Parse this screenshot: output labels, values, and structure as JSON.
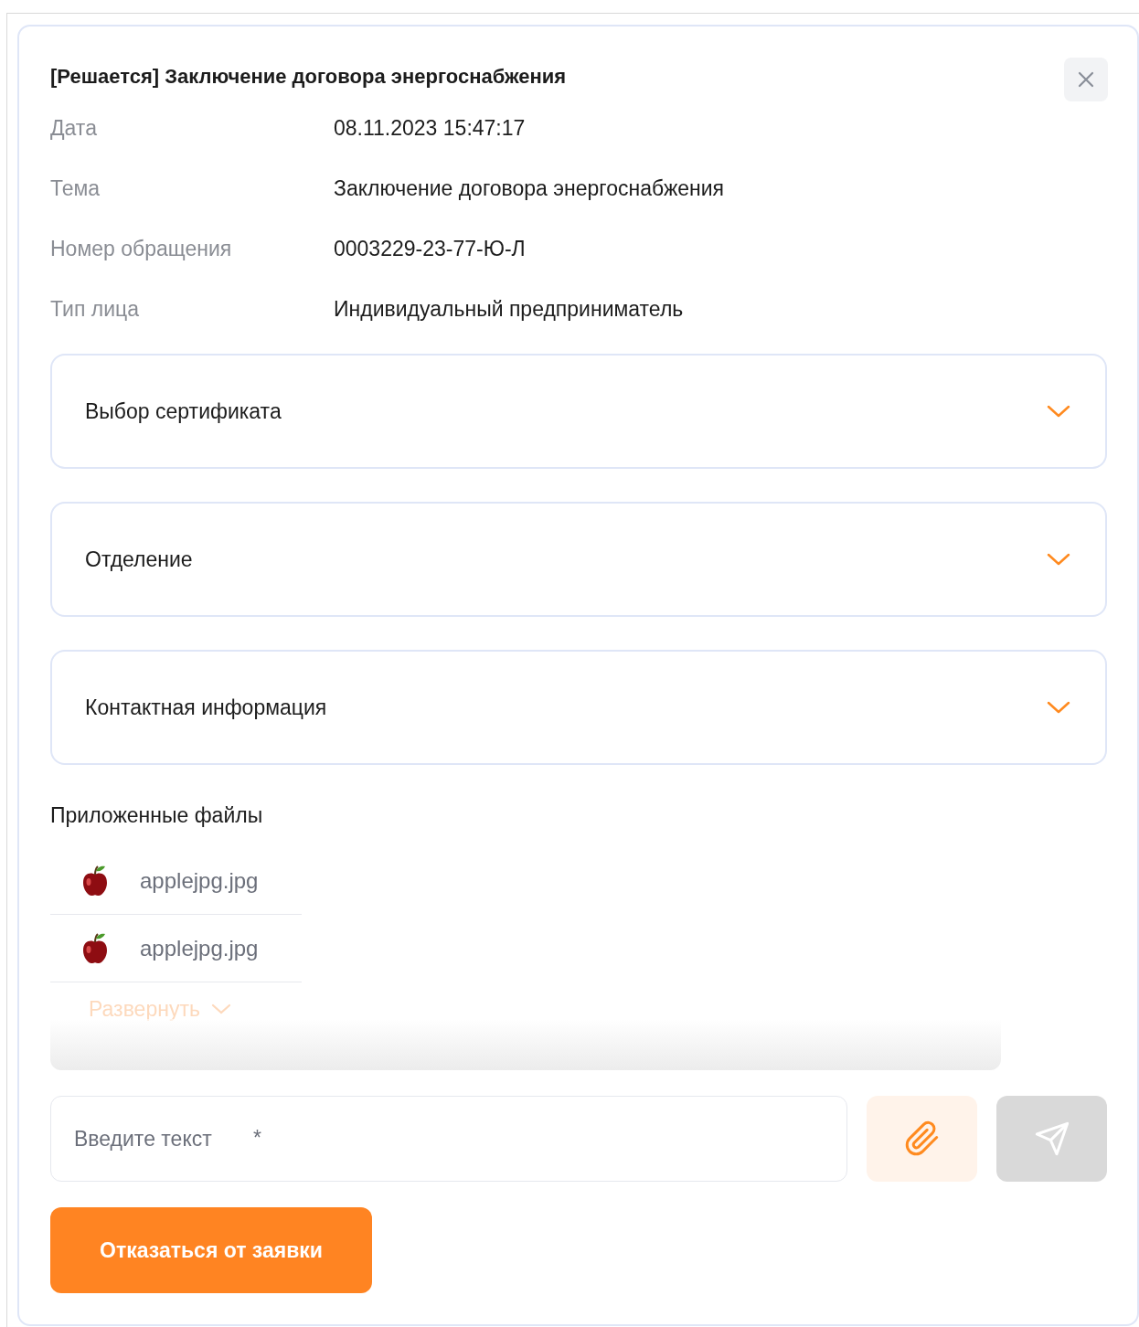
{
  "dialog": {
    "title": "[Решается] Заключение договора энергоснабжения"
  },
  "details": [
    {
      "label": "Дата",
      "value": "08.11.2023 15:47:17"
    },
    {
      "label": "Тема",
      "value": "Заключение договора энергоснабжения"
    },
    {
      "label": "Номер обращения",
      "value": "0003229-23-77-Ю-Л"
    },
    {
      "label": "Тип лица",
      "value": "Индивидуальный предприниматель"
    }
  ],
  "sections": [
    {
      "title": "Выбор сертификата",
      "expanded": false
    },
    {
      "title": "Отделение",
      "expanded": false
    },
    {
      "title": "Контактная информация",
      "expanded": false
    }
  ],
  "attachments": {
    "heading": "Приложенные файлы",
    "files": [
      {
        "name": "applejpg.jpg"
      },
      {
        "name": "applejpg.jpg"
      }
    ],
    "expand_link": "Развернуть"
  },
  "message": {
    "placeholder": "Введите текст",
    "required_mark": "*",
    "send_disabled": true
  },
  "reject_button": "Отказаться от заявки"
}
